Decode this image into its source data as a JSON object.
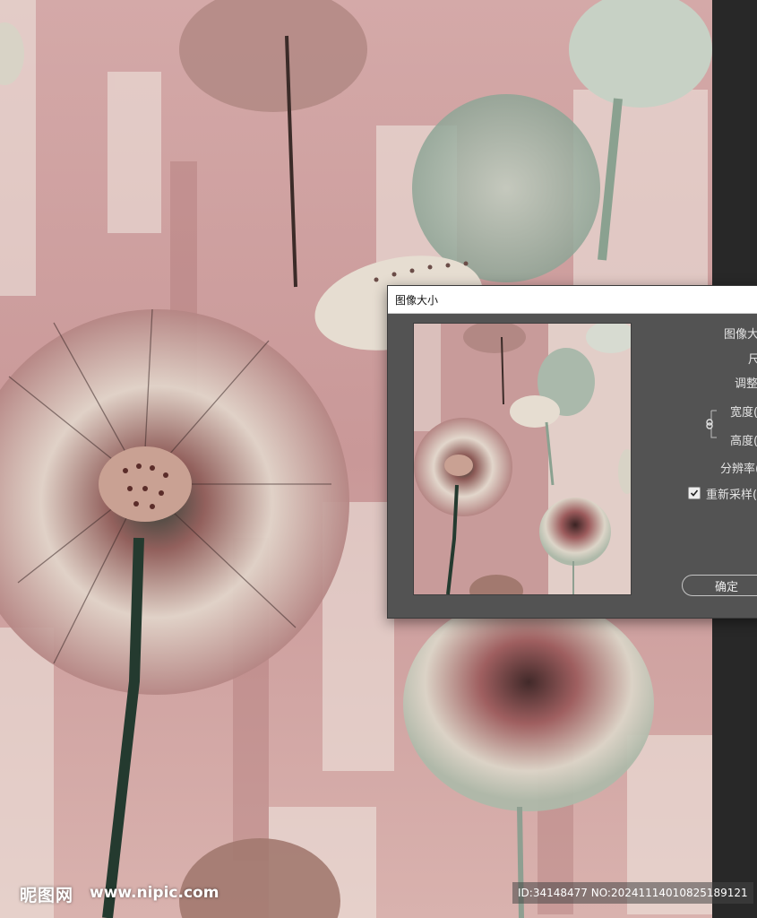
{
  "canvas": {
    "description_icon": "lotus-painting-artwork",
    "colors": {
      "background_pink": "#c9999a",
      "cream": "#ece4dc",
      "sage_green": "#9fb3a3",
      "dark_green": "#1f3a30",
      "burgundy": "#8a4b4d"
    }
  },
  "dialog": {
    "title": "图像大小",
    "labels": {
      "image_size": "图像大",
      "dimensions": "尺",
      "fit_to": "调整",
      "width": "宽度(",
      "height": "高度(",
      "resolution": "分辨率(",
      "resample": "重新采样("
    },
    "resample_checked": true,
    "ok_label": "确定",
    "link_icon": "chain-link-icon"
  },
  "watermark": {
    "brand": "昵图网",
    "url": "www.nipic.com",
    "id_text": "ID:34148477 NO:20241114010825189121"
  }
}
